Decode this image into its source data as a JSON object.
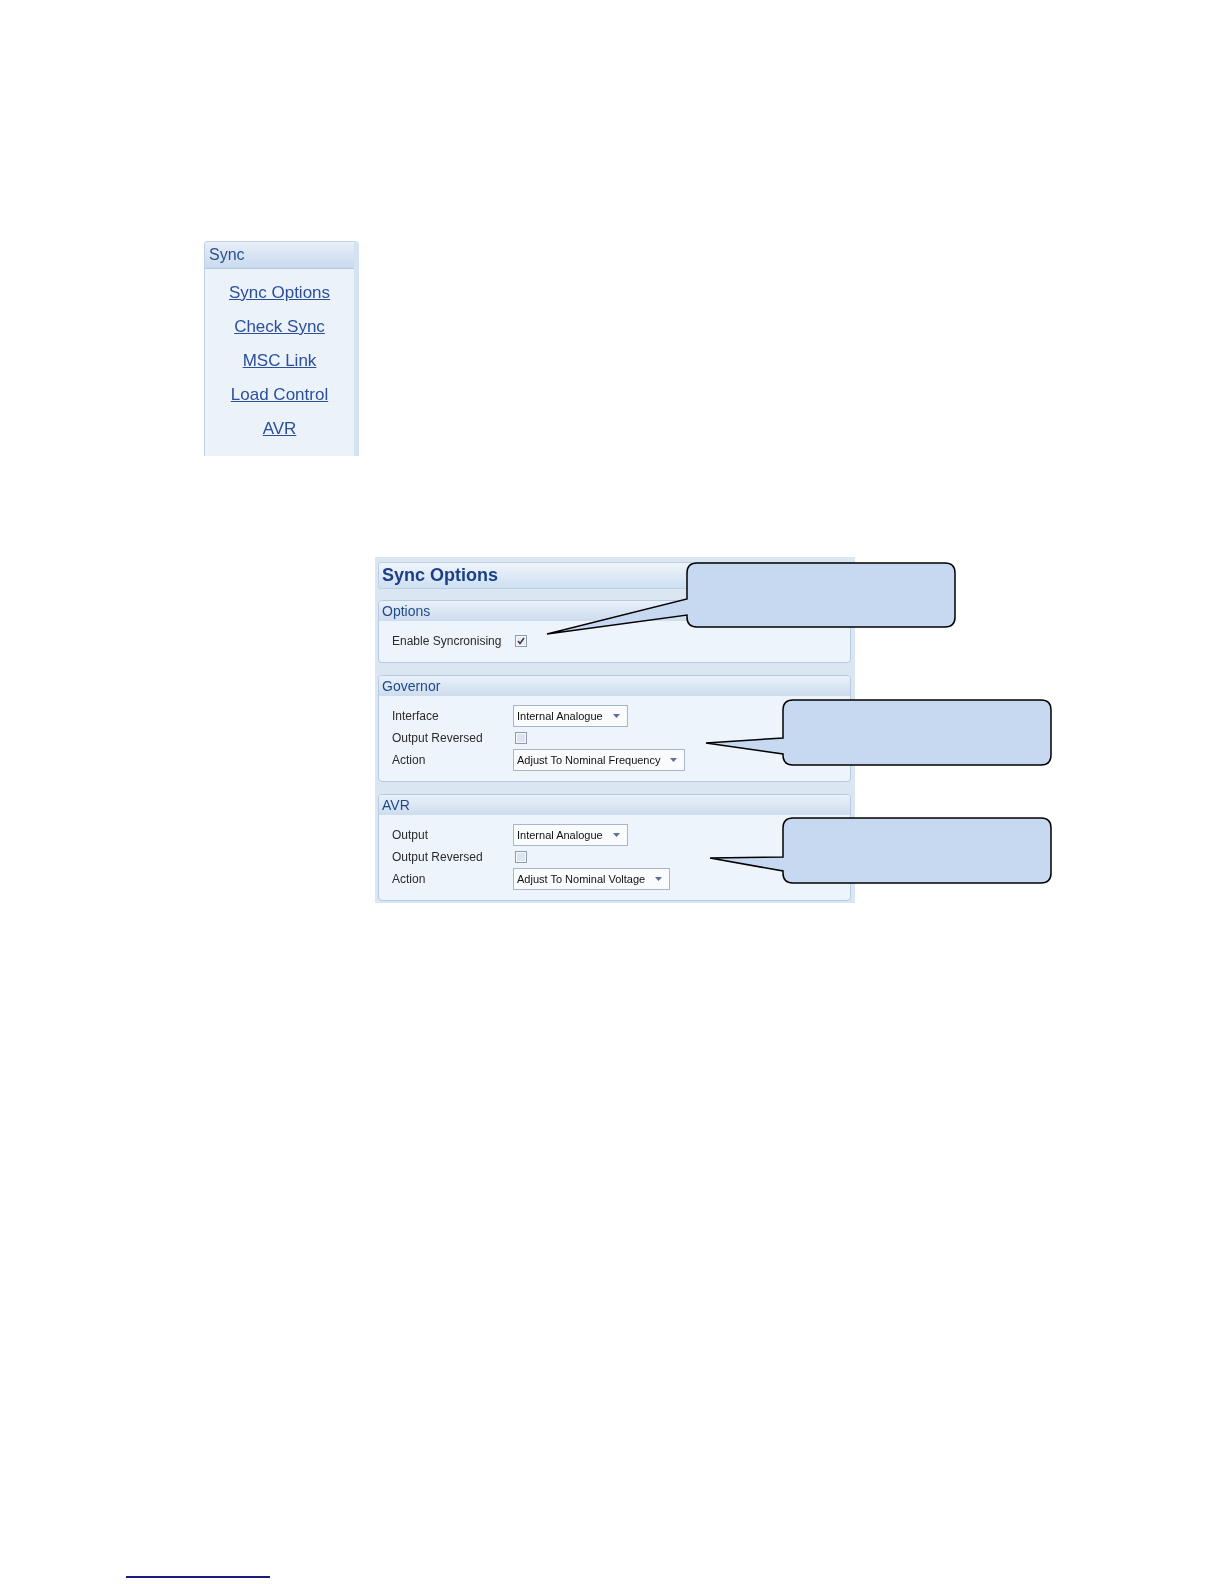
{
  "sidebar": {
    "title": "Sync",
    "links": [
      "Sync Options",
      "Check Sync",
      "MSC Link",
      "Load Control",
      "AVR"
    ]
  },
  "panel": {
    "title": "Sync Options",
    "groups": [
      {
        "title": "Options",
        "rows": [
          {
            "kind": "checkbox",
            "label": "Enable Syncronising",
            "checked": true
          }
        ]
      },
      {
        "title": "Governor",
        "rows": [
          {
            "kind": "dropdown",
            "label": "Interface",
            "value": "Internal Analogue"
          },
          {
            "kind": "checkbox",
            "label": "Output Reversed",
            "checked": false
          },
          {
            "kind": "dropdown",
            "label": "Action",
            "value": "Adjust To Nominal Frequency"
          }
        ]
      },
      {
        "title": "AVR",
        "rows": [
          {
            "kind": "dropdown",
            "label": "Output",
            "value": "Internal Analogue"
          },
          {
            "kind": "checkbox",
            "label": "Output Reversed",
            "checked": false
          },
          {
            "kind": "dropdown",
            "label": "Action",
            "value": "Adjust To Nominal Voltage"
          }
        ]
      }
    ]
  }
}
